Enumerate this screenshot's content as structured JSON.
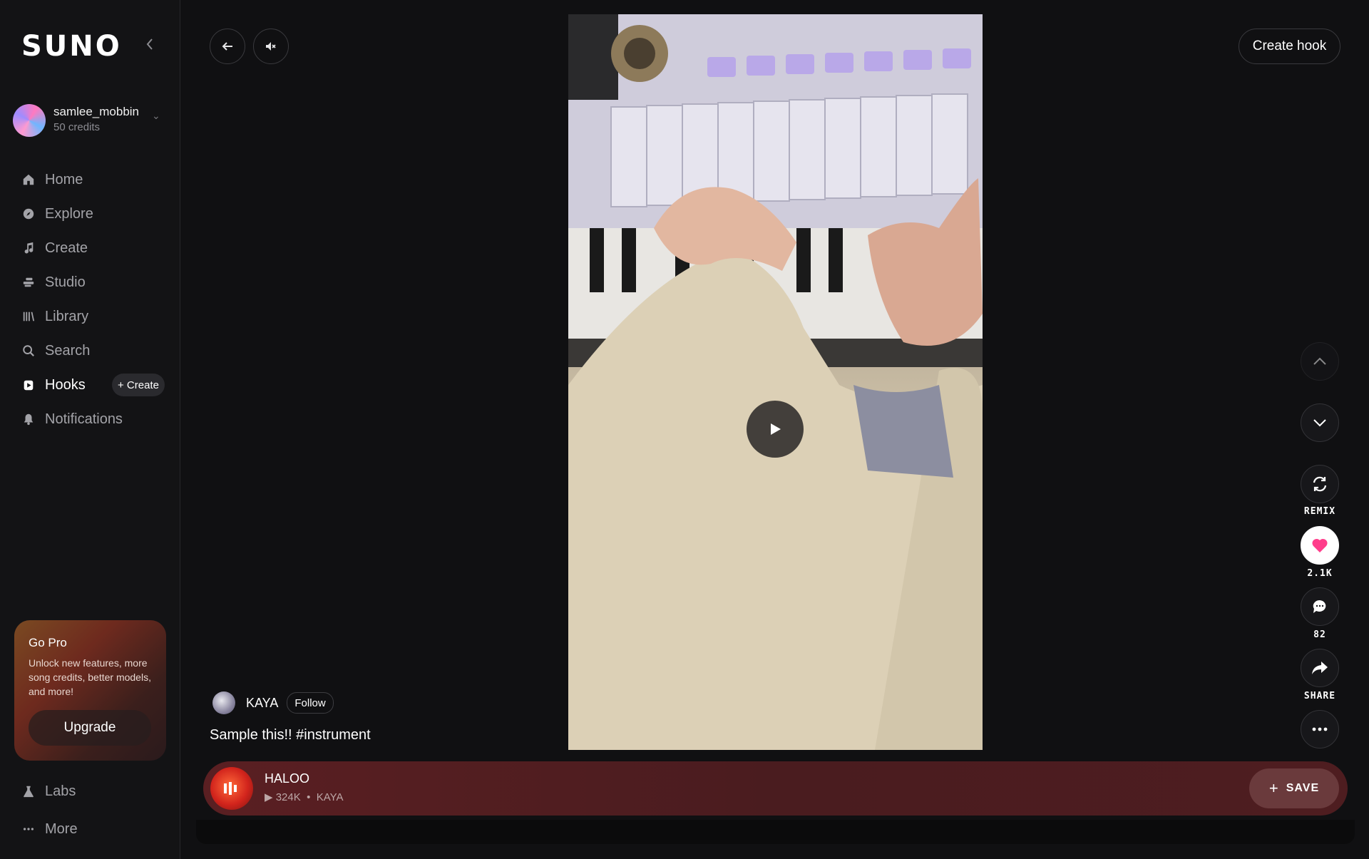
{
  "app": {
    "logo": "SUNO"
  },
  "user": {
    "name": "samlee_mobbin",
    "credits": "50 credits"
  },
  "nav": {
    "items": [
      {
        "label": "Home",
        "icon": "home-icon"
      },
      {
        "label": "Explore",
        "icon": "compass-icon"
      },
      {
        "label": "Create",
        "icon": "music-note-icon"
      },
      {
        "label": "Studio",
        "icon": "studio-icon"
      },
      {
        "label": "Library",
        "icon": "library-icon"
      },
      {
        "label": "Search",
        "icon": "search-icon"
      },
      {
        "label": "Hooks",
        "icon": "hooks-icon",
        "active": true
      },
      {
        "label": "Notifications",
        "icon": "bell-icon"
      }
    ],
    "hooks_create": "+ Create"
  },
  "gopro": {
    "title": "Go Pro",
    "text": "Unlock new features, more song credits, better models, and more!",
    "button": "Upgrade"
  },
  "bottom_nav": {
    "labs": "Labs",
    "more": "More"
  },
  "header": {
    "create_hook": "Create hook"
  },
  "hook": {
    "creator": "KAYA",
    "follow": "Follow",
    "caption": "Sample this!! #instrument"
  },
  "song": {
    "title": "HALOO",
    "plays": "▶ 324K",
    "separator": "•",
    "artist": "KAYA",
    "save": "SAVE",
    "color": "#5a1f22"
  },
  "actions": {
    "remix": "REMIX",
    "likes": "2.1K",
    "comments": "82",
    "share": "SHARE",
    "like_color": "#ff3d8b"
  }
}
